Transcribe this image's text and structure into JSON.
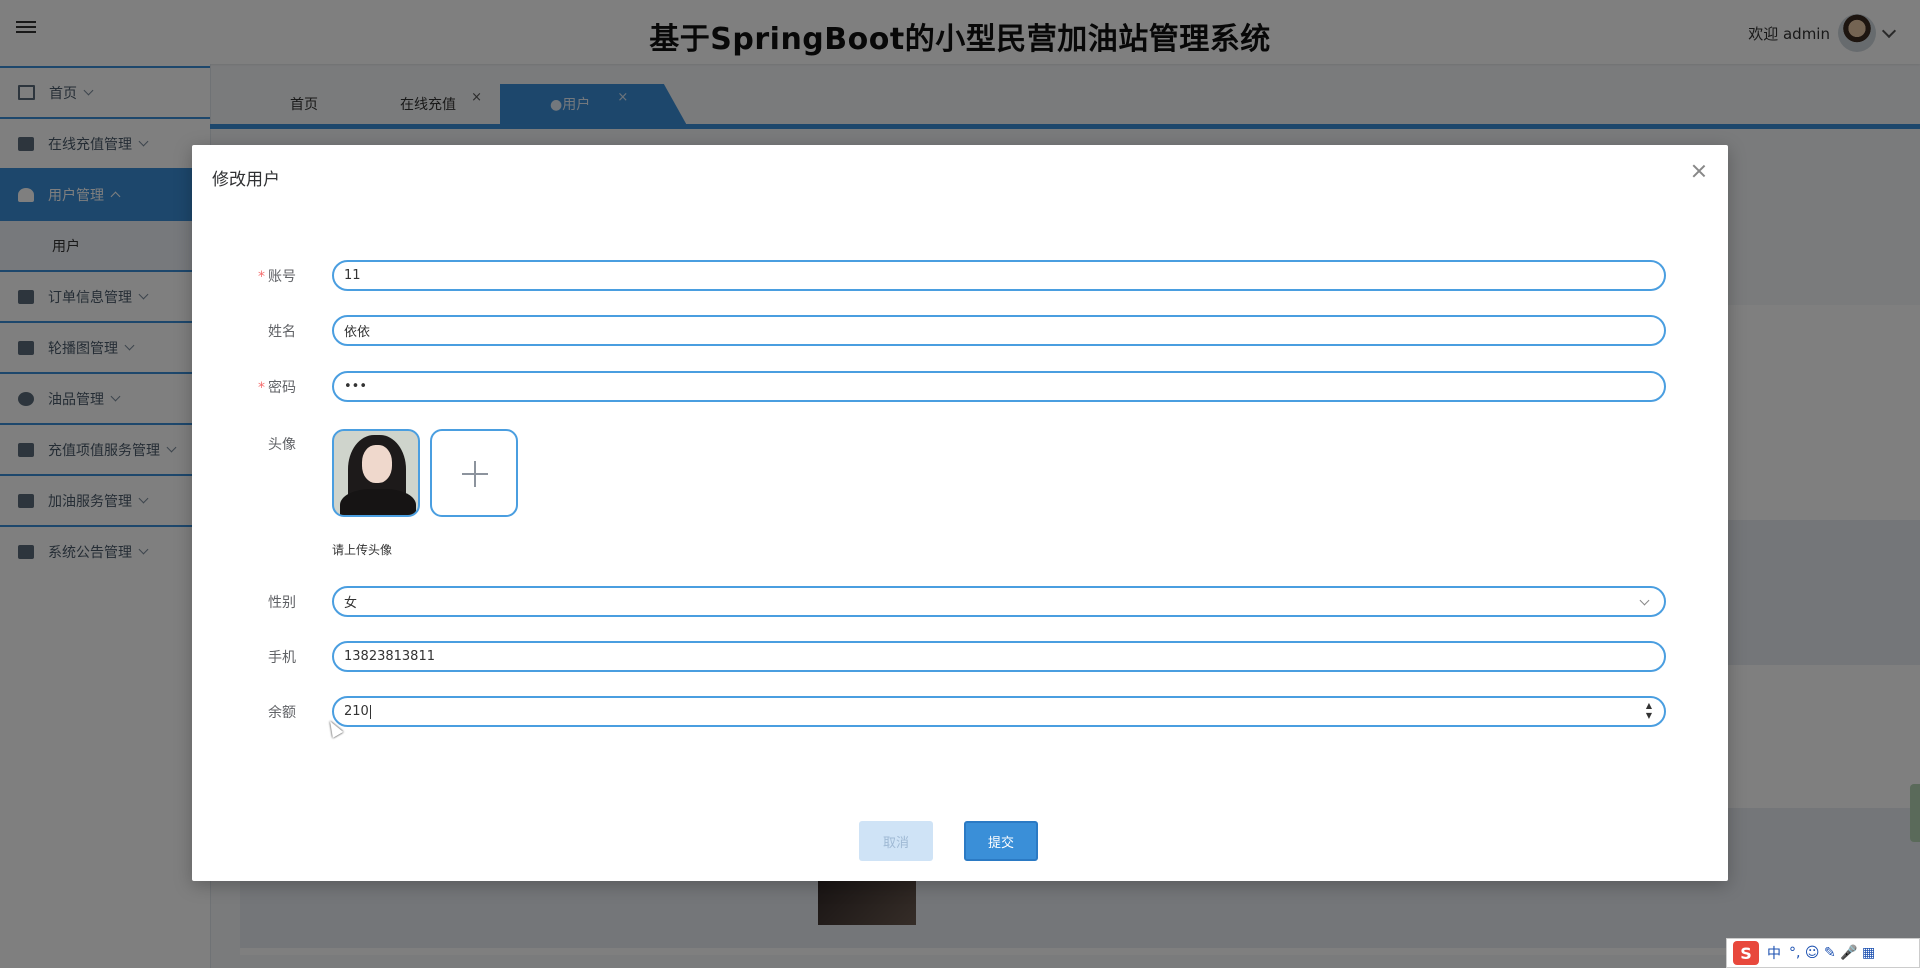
{
  "app": {
    "title": "基于SpringBoot的小型民营加油站管理系统",
    "welcome": "欢迎 admin"
  },
  "sidebar": {
    "items": [
      {
        "label": "首页",
        "icon": "home-icon"
      },
      {
        "label": "在线充值管理",
        "icon": "briefcase-icon"
      },
      {
        "label": "用户管理",
        "icon": "user-icon",
        "active": true
      },
      {
        "label": "订单信息管理",
        "icon": "list-icon"
      },
      {
        "label": "轮播图管理",
        "icon": "image-icon"
      },
      {
        "label": "油品管理",
        "icon": "oil-icon"
      },
      {
        "label": "充值项值服务管理",
        "icon": "columns-icon"
      },
      {
        "label": "加油服务管理",
        "icon": "briefcase-icon"
      },
      {
        "label": "系统公告管理",
        "icon": "store-icon"
      }
    ],
    "submenu": [
      "用户"
    ]
  },
  "tabs": [
    {
      "label": "首页"
    },
    {
      "label": "在线充值",
      "closable": "×"
    },
    {
      "label": "●用户",
      "closable": "×",
      "active": true
    }
  ],
  "dialog": {
    "title": "修改用户",
    "fields": {
      "account": {
        "label": "账号",
        "value": "11",
        "required": "*"
      },
      "name": {
        "label": "姓名",
        "value": "依依"
      },
      "password": {
        "label": "密码",
        "value": "•••",
        "required": "*"
      },
      "avatar": {
        "label": "头像",
        "tip": "请上传头像"
      },
      "gender": {
        "label": "性别",
        "value": "女"
      },
      "phone": {
        "label": "手机",
        "value": "13823813811"
      },
      "balance": {
        "label": "余额",
        "value": "210"
      }
    },
    "buttons": {
      "cancel": "取消",
      "submit": "提交"
    }
  },
  "ime": {
    "label_zh": "中",
    "symbols": "°, ☺ ✎ 🎤 ▦",
    "logo": "S"
  },
  "colors": {
    "accent": "#3a8fd8",
    "required": "#f56c6c"
  }
}
